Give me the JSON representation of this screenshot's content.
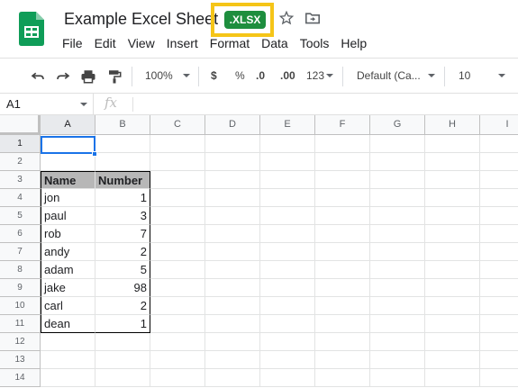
{
  "app": {
    "doc_title": "Example Excel Sheet",
    "file_badge": ".XLSX",
    "brand_color": "#0f9d58",
    "badge_color": "#1e8e3e",
    "highlight_color": "#f5c518"
  },
  "menu": [
    "File",
    "Edit",
    "View",
    "Insert",
    "Format",
    "Data",
    "Tools",
    "Help"
  ],
  "toolbar": {
    "icons": [
      "undo-icon",
      "redo-icon",
      "print-icon",
      "paint-format-icon"
    ],
    "zoom": "100%",
    "currency": "$",
    "percent": "%",
    "decrease_decimal": ".0",
    "increase_decimal": ".00",
    "more_formats": "123",
    "font": "Default (Ca...",
    "font_size": "10"
  },
  "formula_bar": {
    "name_box": "A1",
    "fx_label": "fx",
    "formula": ""
  },
  "grid": {
    "columns": [
      "A",
      "B",
      "C",
      "D",
      "E",
      "F",
      "G",
      "H",
      "I"
    ],
    "rows": [
      "1",
      "2",
      "3",
      "4",
      "5",
      "6",
      "7",
      "8",
      "9",
      "10",
      "11",
      "12",
      "13",
      "14"
    ],
    "selected_cell": "A1",
    "table": {
      "headers": [
        "Name",
        "Number"
      ],
      "rows": [
        [
          "jon",
          "1"
        ],
        [
          "paul",
          "3"
        ],
        [
          "rob",
          "7"
        ],
        [
          "andy",
          "2"
        ],
        [
          "adam",
          "5"
        ],
        [
          "jake",
          "98"
        ],
        [
          "carl",
          "2"
        ],
        [
          "dean",
          "1"
        ]
      ]
    }
  }
}
